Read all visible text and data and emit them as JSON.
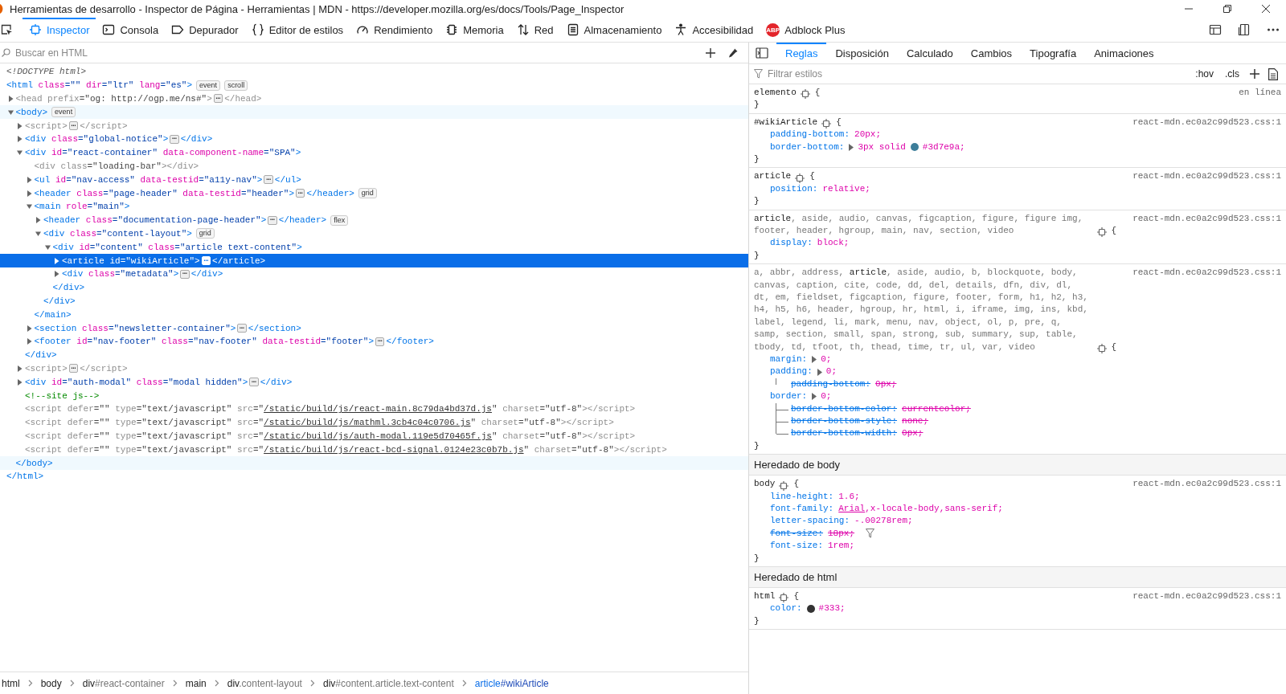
{
  "window": {
    "title": "Herramientas de desarrollo - Inspector de Página - Herramientas | MDN - https://developer.mozilla.org/es/docs/Tools/Page_Inspector"
  },
  "toolbar": {
    "tabs": [
      {
        "kind": "inspector",
        "label": "Inspector",
        "selected": true
      },
      {
        "kind": "console",
        "label": "Consola",
        "selected": false
      },
      {
        "kind": "debugger",
        "label": "Depurador",
        "selected": false
      },
      {
        "kind": "style-editor",
        "label": "Editor de estilos",
        "selected": false
      },
      {
        "kind": "performance",
        "label": "Rendimiento",
        "selected": false
      },
      {
        "kind": "memory",
        "label": "Memoria",
        "selected": false
      },
      {
        "kind": "network",
        "label": "Red",
        "selected": false
      },
      {
        "kind": "storage",
        "label": "Almacenamiento",
        "selected": false
      },
      {
        "kind": "accessibility",
        "label": "Accesibilidad",
        "selected": false
      },
      {
        "kind": "extension",
        "label": "Adblock Plus",
        "logo": "ABP",
        "selected": false
      }
    ]
  },
  "markup": {
    "search": {
      "placeholder": "Buscar en HTML"
    },
    "nodes": [
      {
        "selected": false,
        "hovered": false,
        "tokens": [
          {
            "kind": "doctype",
            "text": "<!DOCTYPE html>"
          }
        ]
      },
      {
        "selected": false,
        "hovered": false,
        "dim": false,
        "tokens": [
          {
            "kind": "tag",
            "text": "<html"
          },
          {
            "kind": "attr",
            "text": " class"
          },
          {
            "kind": "val",
            "text": "=\"\""
          },
          {
            "kind": "attr",
            "text": " dir"
          },
          {
            "kind": "val",
            "text": "=\"ltr\""
          },
          {
            "kind": "attr",
            "text": " lang"
          },
          {
            "kind": "val",
            "text": "=\"es\""
          },
          {
            "kind": "tag",
            "text": ">"
          },
          {
            "kind": "badge",
            "text": "event"
          },
          {
            "kind": "badge",
            "text": "scroll"
          }
        ],
        "close": [
          {
            "kind": "tag",
            "text": "</html>"
          }
        ],
        "children": [
          {
            "selected": false,
            "hovered": false,
            "dim": true,
            "expanded": false,
            "tokens": [
              {
                "kind": "tag",
                "text": "<head"
              },
              {
                "kind": "attr",
                "text": " prefix"
              },
              {
                "kind": "val",
                "text": "=\"og: http://ogp.me/ns#\""
              },
              {
                "kind": "tag",
                "text": ">"
              },
              {
                "kind": "more",
                "text": "⋯"
              },
              {
                "kind": "tag",
                "text": "</head>"
              }
            ]
          },
          {
            "selected": false,
            "hovered": true,
            "dim": false,
            "expanded": true,
            "tokens": [
              {
                "kind": "tag",
                "text": "<body>"
              },
              {
                "kind": "badge",
                "text": "event"
              }
            ],
            "close": [
              {
                "kind": "tag",
                "text": "</body>"
              }
            ],
            "children": [
              {
                "selected": false,
                "hovered": false,
                "dim": true,
                "expanded": false,
                "tokens": [
                  {
                    "kind": "tag",
                    "text": "<script>"
                  },
                  {
                    "kind": "more",
                    "text": "⋯"
                  },
                  {
                    "kind": "tag",
                    "text": "</script>"
                  }
                ]
              },
              {
                "selected": false,
                "hovered": false,
                "dim": false,
                "expanded": false,
                "tokens": [
                  {
                    "kind": "tag",
                    "text": "<div"
                  },
                  {
                    "kind": "attr",
                    "text": " class"
                  },
                  {
                    "kind": "val",
                    "text": "=\"global-notice\""
                  },
                  {
                    "kind": "tag",
                    "text": ">"
                  },
                  {
                    "kind": "more",
                    "text": "⋯"
                  },
                  {
                    "kind": "tag",
                    "text": "</div>"
                  }
                ]
              },
              {
                "selected": false,
                "hovered": false,
                "dim": false,
                "expanded": true,
                "tokens": [
                  {
                    "kind": "tag",
                    "text": "<div"
                  },
                  {
                    "kind": "attr",
                    "text": " id"
                  },
                  {
                    "kind": "val",
                    "text": "=\"react-container\""
                  },
                  {
                    "kind": "attr",
                    "text": " data-component-name"
                  },
                  {
                    "kind": "val",
                    "text": "=\"SPA\""
                  },
                  {
                    "kind": "tag",
                    "text": ">"
                  }
                ],
                "close": [
                  {
                    "kind": "tag",
                    "text": "</div>"
                  }
                ],
                "children": [
                  {
                    "selected": false,
                    "hovered": false,
                    "dim": true,
                    "tokens": [
                      {
                        "kind": "tag",
                        "text": "<div"
                      },
                      {
                        "kind": "attr",
                        "text": " class"
                      },
                      {
                        "kind": "val",
                        "text": "=\"loading-bar\""
                      },
                      {
                        "kind": "tag",
                        "text": "></div>"
                      }
                    ]
                  },
                  {
                    "selected": false,
                    "hovered": false,
                    "dim": false,
                    "expanded": false,
                    "tokens": [
                      {
                        "kind": "tag",
                        "text": "<ul"
                      },
                      {
                        "kind": "attr",
                        "text": " id"
                      },
                      {
                        "kind": "val",
                        "text": "=\"nav-access\""
                      },
                      {
                        "kind": "attr",
                        "text": " data-testid"
                      },
                      {
                        "kind": "val",
                        "text": "=\"a11y-nav\""
                      },
                      {
                        "kind": "tag",
                        "text": ">"
                      },
                      {
                        "kind": "more",
                        "text": "⋯"
                      },
                      {
                        "kind": "tag",
                        "text": "</ul>"
                      }
                    ]
                  },
                  {
                    "selected": false,
                    "hovered": false,
                    "dim": false,
                    "expanded": false,
                    "tokens": [
                      {
                        "kind": "tag",
                        "text": "<header"
                      },
                      {
                        "kind": "attr",
                        "text": " class"
                      },
                      {
                        "kind": "val",
                        "text": "=\"page-header\""
                      },
                      {
                        "kind": "attr",
                        "text": " data-testid"
                      },
                      {
                        "kind": "val",
                        "text": "=\"header\""
                      },
                      {
                        "kind": "tag",
                        "text": ">"
                      },
                      {
                        "kind": "more",
                        "text": "⋯"
                      },
                      {
                        "kind": "tag",
                        "text": "</header>"
                      },
                      {
                        "kind": "badge",
                        "text": "grid"
                      }
                    ]
                  },
                  {
                    "selected": false,
                    "hovered": false,
                    "dim": false,
                    "expanded": true,
                    "tokens": [
                      {
                        "kind": "tag",
                        "text": "<main"
                      },
                      {
                        "kind": "attr",
                        "text": " role"
                      },
                      {
                        "kind": "val",
                        "text": "=\"main\""
                      },
                      {
                        "kind": "tag",
                        "text": ">"
                      }
                    ],
                    "close": [
                      {
                        "kind": "tag",
                        "text": "</main>"
                      }
                    ],
                    "children": [
                      {
                        "selected": false,
                        "hovered": false,
                        "dim": false,
                        "expanded": false,
                        "tokens": [
                          {
                            "kind": "tag",
                            "text": "<header"
                          },
                          {
                            "kind": "attr",
                            "text": " class"
                          },
                          {
                            "kind": "val",
                            "text": "=\"documentation-page-header\""
                          },
                          {
                            "kind": "tag",
                            "text": ">"
                          },
                          {
                            "kind": "more",
                            "text": "⋯"
                          },
                          {
                            "kind": "tag",
                            "text": "</header>"
                          },
                          {
                            "kind": "badge",
                            "text": "flex"
                          }
                        ]
                      },
                      {
                        "selected": false,
                        "hovered": false,
                        "dim": false,
                        "expanded": true,
                        "tokens": [
                          {
                            "kind": "tag",
                            "text": "<div"
                          },
                          {
                            "kind": "attr",
                            "text": " class"
                          },
                          {
                            "kind": "val",
                            "text": "=\"content-layout\""
                          },
                          {
                            "kind": "tag",
                            "text": ">"
                          },
                          {
                            "kind": "badge",
                            "text": "grid"
                          }
                        ],
                        "close": [
                          {
                            "kind": "tag",
                            "text": "</div>"
                          }
                        ],
                        "children": [
                          {
                            "selected": false,
                            "hovered": false,
                            "dim": false,
                            "expanded": true,
                            "tokens": [
                              {
                                "kind": "tag",
                                "text": "<div"
                              },
                              {
                                "kind": "attr",
                                "text": " id"
                              },
                              {
                                "kind": "val",
                                "text": "=\"content\""
                              },
                              {
                                "kind": "attr",
                                "text": " class"
                              },
                              {
                                "kind": "val",
                                "text": "=\"article text-content\""
                              },
                              {
                                "kind": "tag",
                                "text": ">"
                              }
                            ],
                            "close": [
                              {
                                "kind": "tag",
                                "text": "</div>"
                              }
                            ],
                            "children": [
                              {
                                "selected": true,
                                "hovered": false,
                                "dim": false,
                                "expanded": false,
                                "tokens": [
                                  {
                                    "kind": "tag",
                                    "text": "<article"
                                  },
                                  {
                                    "kind": "attr",
                                    "text": " id"
                                  },
                                  {
                                    "kind": "val",
                                    "text": "=\"wikiArticle\""
                                  },
                                  {
                                    "kind": "tag",
                                    "text": ">"
                                  },
                                  {
                                    "kind": "more",
                                    "text": "⋯"
                                  },
                                  {
                                    "kind": "tag",
                                    "text": "</article>"
                                  }
                                ]
                              },
                              {
                                "selected": false,
                                "hovered": false,
                                "dim": false,
                                "expanded": false,
                                "tokens": [
                                  {
                                    "kind": "tag",
                                    "text": "<div"
                                  },
                                  {
                                    "kind": "attr",
                                    "text": " class"
                                  },
                                  {
                                    "kind": "val",
                                    "text": "=\"metadata\""
                                  },
                                  {
                                    "kind": "tag",
                                    "text": ">"
                                  },
                                  {
                                    "kind": "more",
                                    "text": "⋯"
                                  },
                                  {
                                    "kind": "tag",
                                    "text": "</div>"
                                  }
                                ]
                              }
                            ]
                          }
                        ]
                      }
                    ]
                  },
                  {
                    "selected": false,
                    "hovered": false,
                    "dim": false,
                    "expanded": false,
                    "tokens": [
                      {
                        "kind": "tag",
                        "text": "<section"
                      },
                      {
                        "kind": "attr",
                        "text": " class"
                      },
                      {
                        "kind": "val",
                        "text": "=\"newsletter-container\""
                      },
                      {
                        "kind": "tag",
                        "text": ">"
                      },
                      {
                        "kind": "more",
                        "text": "⋯"
                      },
                      {
                        "kind": "tag",
                        "text": "</section>"
                      }
                    ]
                  },
                  {
                    "selected": false,
                    "hovered": false,
                    "dim": false,
                    "expanded": false,
                    "tokens": [
                      {
                        "kind": "tag",
                        "text": "<footer"
                      },
                      {
                        "kind": "attr",
                        "text": " id"
                      },
                      {
                        "kind": "val",
                        "text": "=\"nav-footer\""
                      },
                      {
                        "kind": "attr",
                        "text": " class"
                      },
                      {
                        "kind": "val",
                        "text": "=\"nav-footer\""
                      },
                      {
                        "kind": "attr",
                        "text": " data-testid"
                      },
                      {
                        "kind": "val",
                        "text": "=\"footer\""
                      },
                      {
                        "kind": "tag",
                        "text": ">"
                      },
                      {
                        "kind": "more",
                        "text": "⋯"
                      },
                      {
                        "kind": "tag",
                        "text": "</footer>"
                      }
                    ]
                  }
                ]
              },
              {
                "selected": false,
                "hovered": false,
                "dim": true,
                "expanded": false,
                "tokens": [
                  {
                    "kind": "tag",
                    "text": "<script>"
                  },
                  {
                    "kind": "more",
                    "text": "⋯"
                  },
                  {
                    "kind": "tag",
                    "text": "</script>"
                  }
                ]
              },
              {
                "selected": false,
                "hovered": false,
                "dim": false,
                "expanded": false,
                "tokens": [
                  {
                    "kind": "tag",
                    "text": "<div"
                  },
                  {
                    "kind": "attr",
                    "text": " id"
                  },
                  {
                    "kind": "val",
                    "text": "=\"auth-modal\""
                  },
                  {
                    "kind": "attr",
                    "text": " class"
                  },
                  {
                    "kind": "val",
                    "text": "=\"modal hidden\""
                  },
                  {
                    "kind": "tag",
                    "text": ">"
                  },
                  {
                    "kind": "more",
                    "text": "⋯"
                  },
                  {
                    "kind": "tag",
                    "text": "</div>"
                  }
                ]
              },
              {
                "selected": false,
                "hovered": false,
                "tokens": [
                  {
                    "kind": "comment",
                    "text": "<!--site js-->"
                  }
                ]
              },
              {
                "selected": false,
                "hovered": false,
                "dim": true,
                "tokens": [
                  {
                    "kind": "tag",
                    "text": "<script"
                  },
                  {
                    "kind": "attr",
                    "text": " defer"
                  },
                  {
                    "kind": "val",
                    "text": "=\"\""
                  },
                  {
                    "kind": "attr",
                    "text": " type"
                  },
                  {
                    "kind": "val",
                    "text": "=\"text/javascript\""
                  },
                  {
                    "kind": "attr",
                    "text": " src"
                  },
                  {
                    "kind": "val",
                    "text": "=\""
                  },
                  {
                    "kind": "link",
                    "text": "/static/build/js/react-main.8c79da4bd37d.js"
                  },
                  {
                    "kind": "val",
                    "text": "\""
                  },
                  {
                    "kind": "attr",
                    "text": " charset"
                  },
                  {
                    "kind": "val",
                    "text": "=\"utf-8\""
                  },
                  {
                    "kind": "tag",
                    "text": "></script>"
                  }
                ]
              },
              {
                "selected": false,
                "hovered": false,
                "dim": true,
                "tokens": [
                  {
                    "kind": "tag",
                    "text": "<script"
                  },
                  {
                    "kind": "attr",
                    "text": " defer"
                  },
                  {
                    "kind": "val",
                    "text": "=\"\""
                  },
                  {
                    "kind": "attr",
                    "text": " type"
                  },
                  {
                    "kind": "val",
                    "text": "=\"text/javascript\""
                  },
                  {
                    "kind": "attr",
                    "text": " src"
                  },
                  {
                    "kind": "val",
                    "text": "=\""
                  },
                  {
                    "kind": "link",
                    "text": "/static/build/js/mathml.3cb4c04c0706.js"
                  },
                  {
                    "kind": "val",
                    "text": "\""
                  },
                  {
                    "kind": "attr",
                    "text": " charset"
                  },
                  {
                    "kind": "val",
                    "text": "=\"utf-8\""
                  },
                  {
                    "kind": "tag",
                    "text": "></script>"
                  }
                ]
              },
              {
                "selected": false,
                "hovered": false,
                "dim": true,
                "tokens": [
                  {
                    "kind": "tag",
                    "text": "<script"
                  },
                  {
                    "kind": "attr",
                    "text": " defer"
                  },
                  {
                    "kind": "val",
                    "text": "=\"\""
                  },
                  {
                    "kind": "attr",
                    "text": " type"
                  },
                  {
                    "kind": "val",
                    "text": "=\"text/javascript\""
                  },
                  {
                    "kind": "attr",
                    "text": " src"
                  },
                  {
                    "kind": "val",
                    "text": "=\""
                  },
                  {
                    "kind": "link",
                    "text": "/static/build/js/auth-modal.119e5d70465f.js"
                  },
                  {
                    "kind": "val",
                    "text": "\""
                  },
                  {
                    "kind": "attr",
                    "text": " charset"
                  },
                  {
                    "kind": "val",
                    "text": "=\"utf-8\""
                  },
                  {
                    "kind": "tag",
                    "text": "></script>"
                  }
                ]
              },
              {
                "selected": false,
                "hovered": false,
                "dim": true,
                "tokens": [
                  {
                    "kind": "tag",
                    "text": "<script"
                  },
                  {
                    "kind": "attr",
                    "text": " defer"
                  },
                  {
                    "kind": "val",
                    "text": "=\"\""
                  },
                  {
                    "kind": "attr",
                    "text": " type"
                  },
                  {
                    "kind": "val",
                    "text": "=\"text/javascript\""
                  },
                  {
                    "kind": "attr",
                    "text": " src"
                  },
                  {
                    "kind": "val",
                    "text": "=\""
                  },
                  {
                    "kind": "link",
                    "text": "/static/build/js/react-bcd-signal.0124e23c0b7b.js"
                  },
                  {
                    "kind": "val",
                    "text": "\""
                  },
                  {
                    "kind": "attr",
                    "text": " charset"
                  },
                  {
                    "kind": "val",
                    "text": "=\"utf-8\""
                  },
                  {
                    "kind": "tag",
                    "text": "></script>"
                  }
                ]
              }
            ]
          }
        ]
      }
    ]
  },
  "breadcrumbs": [
    {
      "tag": "html",
      "selected": false
    },
    {
      "tag": "body",
      "selected": false
    },
    {
      "tag": "div",
      "detail": "#react-container",
      "selected": false
    },
    {
      "tag": "main",
      "selected": false
    },
    {
      "tag": "div",
      "detail": ".content-layout",
      "selected": false
    },
    {
      "tag": "div",
      "detail": "#content.article.text-content",
      "selected": false
    },
    {
      "tag": "article",
      "detail": "#wikiArticle",
      "selected": true
    }
  ],
  "rules_panel": {
    "tabs": [
      {
        "label": "Reglas",
        "selected": true
      },
      {
        "label": "Disposición",
        "selected": false
      },
      {
        "label": "Calculado",
        "selected": false
      },
      {
        "label": "Cambios",
        "selected": false
      },
      {
        "label": "Tipografía",
        "selected": false
      },
      {
        "label": "Animaciones",
        "selected": false
      }
    ],
    "filter": {
      "placeholder": "Filtrar estilos"
    },
    "buttons": [
      ":hov",
      ".cls"
    ],
    "rules": [
      {
        "kind": "rule",
        "selector": "elemento",
        "matched": true,
        "open": "{",
        "close": "}",
        "source": "en línea"
      },
      {
        "kind": "rule",
        "selector": "#wikiArticle",
        "matched": true,
        "open": "{",
        "close": "}",
        "source": "react-mdn.ec0a2c99d523.css:1",
        "declarations": [
          {
            "name": "padding-bottom:",
            "overridden": false,
            "parts": [
              {
                "kind": "text",
                "text": "20px;"
              }
            ]
          },
          {
            "name": "border-bottom:",
            "overridden": false,
            "twisty": true,
            "parts": [
              {
                "kind": "text",
                "text": "3px solid"
              },
              {
                "kind": "swatch",
                "color": "#3d7e9a"
              },
              {
                "kind": "text",
                "text": "#3d7e9a;"
              }
            ]
          }
        ]
      },
      {
        "kind": "rule",
        "selector": "article",
        "matched": true,
        "open": "{",
        "close": "}",
        "source": "react-mdn.ec0a2c99d523.css:1",
        "declarations": [
          {
            "name": "position:",
            "overridden": false,
            "parts": [
              {
                "kind": "text",
                "text": "relative;"
              }
            ]
          }
        ]
      },
      {
        "kind": "rule",
        "selector": "**article**, aside, audio, canvas, figcaption, figure, figure img, footer, header, hgroup, main, nav, section, video",
        "matched": false,
        "open": "{",
        "close": "}",
        "source": "react-mdn.ec0a2c99d523.css:1",
        "declarations": [
          {
            "name": "display:",
            "overridden": false,
            "parts": [
              {
                "kind": "text",
                "text": "block;"
              }
            ]
          }
        ]
      },
      {
        "kind": "rule",
        "selector": "a, abbr, address, **article**, aside, audio, b, blockquote, body, canvas, caption, cite, code, dd, del, details, dfn, div, dl, dt, em, fieldset, figcaption, figure, footer, form, h1, h2, h3, h4, h5, h6, header, hgroup, hr, html, i, iframe, img, ins, kbd, label, legend, li, mark, menu, nav, object, ol, p, pre, q, samp, section, small, span, strong, sub, summary, sup, table, tbody, td, tfoot, th, thead, time, tr, ul, var, video",
        "matched": false,
        "open": "{",
        "close": "}",
        "source": "react-mdn.ec0a2c99d523.css:1",
        "declarations": [
          {
            "name": "margin:",
            "overridden": false,
            "twisty": true,
            "parts": [
              {
                "kind": "text",
                "text": "0;"
              }
            ]
          },
          {
            "name": "padding:",
            "overridden": false,
            "twisty": true,
            "parts": [
              {
                "kind": "text",
                "text": "0;"
              }
            ],
            "children": [
              {
                "name": "padding-bottom:",
                "overridden": true,
                "parts": [
                  {
                    "kind": "text",
                    "text": "0px;"
                  }
                ]
              }
            ]
          },
          {
            "name": "border:",
            "overridden": false,
            "twisty": true,
            "parts": [
              {
                "kind": "text",
                "text": "0;"
              }
            ],
            "children": [
              {
                "name": "border-bottom-color:",
                "overridden": true,
                "parts": [
                  {
                    "kind": "text",
                    "text": "currentcolor;"
                  }
                ]
              },
              {
                "name": "border-bottom-style:",
                "overridden": true,
                "parts": [
                  {
                    "kind": "text",
                    "text": "none;"
                  }
                ]
              },
              {
                "name": "border-bottom-width:",
                "overridden": true,
                "parts": [
                  {
                    "kind": "text",
                    "text": "0px;"
                  }
                ]
              }
            ]
          }
        ]
      },
      {
        "kind": "heading",
        "text": "Heredado de body"
      },
      {
        "kind": "rule",
        "selector": "body",
        "matched": true,
        "open": "{",
        "close": "}",
        "source": "react-mdn.ec0a2c99d523.css:1",
        "declarations": [
          {
            "name": "line-height:",
            "overridden": false,
            "parts": [
              {
                "kind": "text",
                "text": "1.6;"
              }
            ]
          },
          {
            "name": "font-family:",
            "overridden": false,
            "parts": [
              {
                "kind": "link",
                "text": "Arial"
              },
              {
                "kind": "text",
                "text": ",x-locale-body,sans-serif;"
              }
            ]
          },
          {
            "name": "letter-spacing:",
            "overridden": false,
            "parts": [
              {
                "kind": "text",
                "text": "-.00278rem;"
              }
            ]
          },
          {
            "name": "font-size:",
            "overridden": true,
            "filter": true,
            "parts": [
              {
                "kind": "text",
                "text": "18px;"
              }
            ]
          },
          {
            "name": "font-size:",
            "overridden": false,
            "parts": [
              {
                "kind": "text",
                "text": "1rem;"
              }
            ]
          }
        ]
      },
      {
        "kind": "heading",
        "text": "Heredado de html"
      },
      {
        "kind": "rule",
        "selector": "html",
        "matched": true,
        "open": "{",
        "close": "}",
        "source": "react-mdn.ec0a2c99d523.css:1",
        "declarations": [
          {
            "name": "color:",
            "overridden": false,
            "parts": [
              {
                "kind": "swatch",
                "color": "#333333"
              },
              {
                "kind": "text",
                "text": "#333;"
              }
            ]
          }
        ]
      }
    ]
  }
}
